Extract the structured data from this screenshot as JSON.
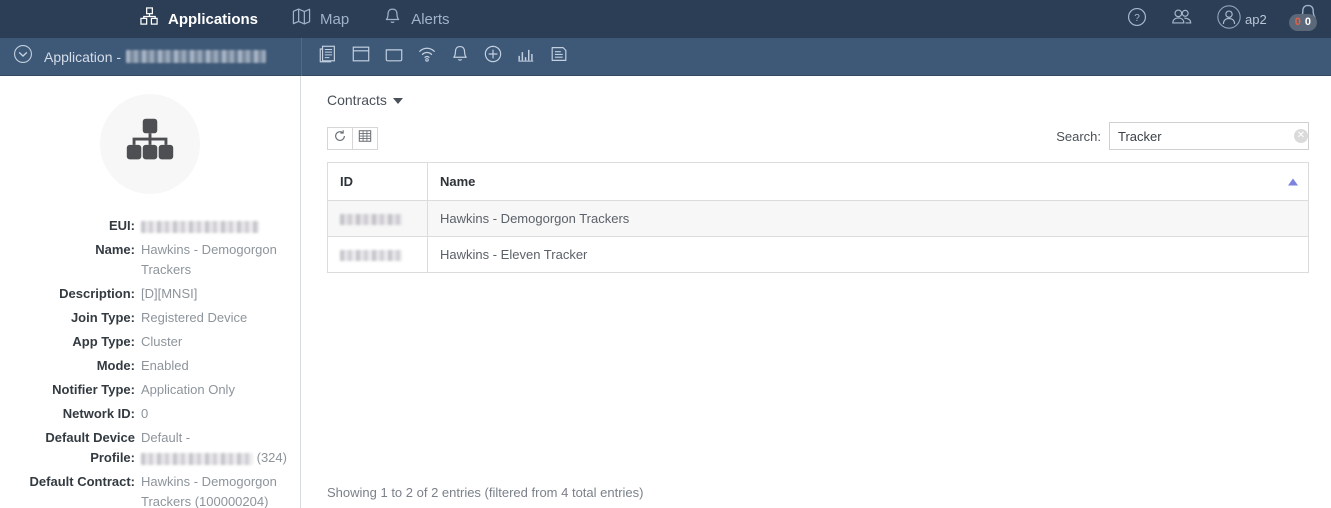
{
  "topnav": {
    "items": [
      {
        "label": "Applications",
        "icon": "sitemap-icon",
        "active": true
      },
      {
        "label": "Map",
        "icon": "map-icon",
        "active": false
      },
      {
        "label": "Alerts",
        "icon": "bell-icon",
        "active": false
      }
    ],
    "help_icon": "help-circle-icon",
    "users_icon": "users-icon",
    "user_avatar_icon": "user-avatar-icon",
    "user_name": "ap2",
    "alert_bell_icon": "bell-badge-icon",
    "badge_critical": "0",
    "badge_normal": "0"
  },
  "subheader": {
    "collapse_icon": "chevron-down-circle-icon",
    "breadcrumb_prefix": "Application -",
    "breadcrumb_value_redacted": true,
    "tools": [
      {
        "icon": "details-list-icon"
      },
      {
        "icon": "window-icon"
      },
      {
        "icon": "folder-icon"
      },
      {
        "icon": "wifi-signal-icon"
      },
      {
        "icon": "bell-icon"
      },
      {
        "icon": "plus-circle-icon"
      },
      {
        "icon": "bar-chart-icon"
      },
      {
        "icon": "document-icon"
      }
    ]
  },
  "leftpanel": {
    "avatar_icon": "sitemap-hierarchy-icon",
    "fields": [
      {
        "label": "EUI:",
        "value": "",
        "redacted": true
      },
      {
        "label": "Name:",
        "value": "Hawkins - Demogorgon Trackers",
        "redacted": false
      },
      {
        "label": "Description:",
        "value": "[D][MNSI]",
        "redacted": false
      },
      {
        "label": "Join Type:",
        "value": "Registered Device",
        "redacted": false
      },
      {
        "label": "App Type:",
        "value": "Cluster",
        "redacted": false
      },
      {
        "label": "Mode:",
        "value": "Enabled",
        "redacted": false
      },
      {
        "label": "Notifier Type:",
        "value": "Application Only",
        "redacted": false
      },
      {
        "label": "Network ID:",
        "value": "0",
        "redacted": false
      },
      {
        "label": "Default Device Profile:",
        "value": "Default -",
        "value_suffix": "(324)",
        "redacted": "partial"
      },
      {
        "label": "Default Contract:",
        "value": "Hawkins - Demogorgon Trackers (100000204)",
        "redacted": false
      }
    ]
  },
  "content": {
    "section_dropdown": "Contracts",
    "refresh_icon": "refresh-icon",
    "columns_icon": "column-chooser-icon",
    "search_label": "Search:",
    "search_value": "Tracker",
    "search_placeholder": "",
    "clear_icon": "clear-circle-icon",
    "table": {
      "headers": [
        "ID",
        "Name"
      ],
      "sort_column": "Name",
      "sort_direction": "asc",
      "rows": [
        {
          "id": "",
          "id_redacted": true,
          "name": "Hawkins - Demogorgon Trackers",
          "highlighted": true
        },
        {
          "id": "",
          "id_redacted": true,
          "name": "Hawkins - Eleven Tracker",
          "highlighted": false
        }
      ]
    },
    "footer": "Showing 1 to 2 of 2 entries (filtered from 4 total entries)"
  },
  "colors": {
    "topnav_bg": "#2b3e55",
    "subheader_bg": "#3e5878",
    "sort_arrow": "#7b83df",
    "badge_red": "#e0624a",
    "label_text": "#333a40",
    "value_text": "#8d949b"
  }
}
